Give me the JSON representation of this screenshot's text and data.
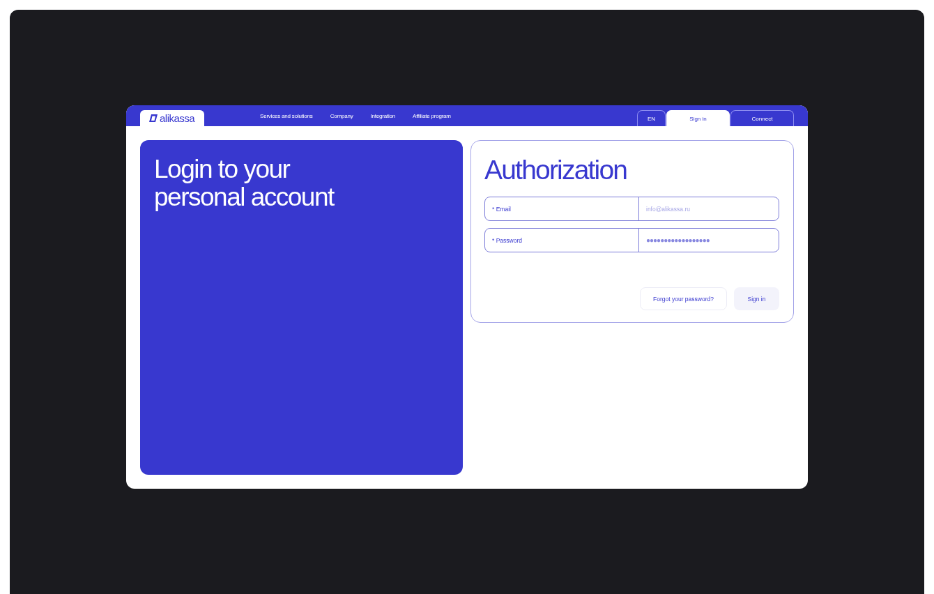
{
  "header": {
    "logo": "alikassa",
    "nav": [
      "Services and solutions",
      "Company",
      "Integration",
      "Affiliate program"
    ],
    "tabs": [
      {
        "label": "EN",
        "selected": false
      },
      {
        "label": "Sign in",
        "selected": true
      },
      {
        "label": "Connect",
        "selected": false
      }
    ]
  },
  "promo": {
    "title": "Login to your personal account"
  },
  "form": {
    "title": "Authorization",
    "fields": [
      {
        "label": "* Email",
        "kind": "text",
        "placeholder": "info@alikassa.ru"
      },
      {
        "label": "* Password",
        "kind": "password",
        "value": "●●●●●●●●●●●●●●●●●●"
      }
    ],
    "buttons": [
      {
        "label": "Forgot your password?",
        "kind": "outline"
      },
      {
        "label": "Sign in",
        "kind": "filled"
      }
    ]
  }
}
